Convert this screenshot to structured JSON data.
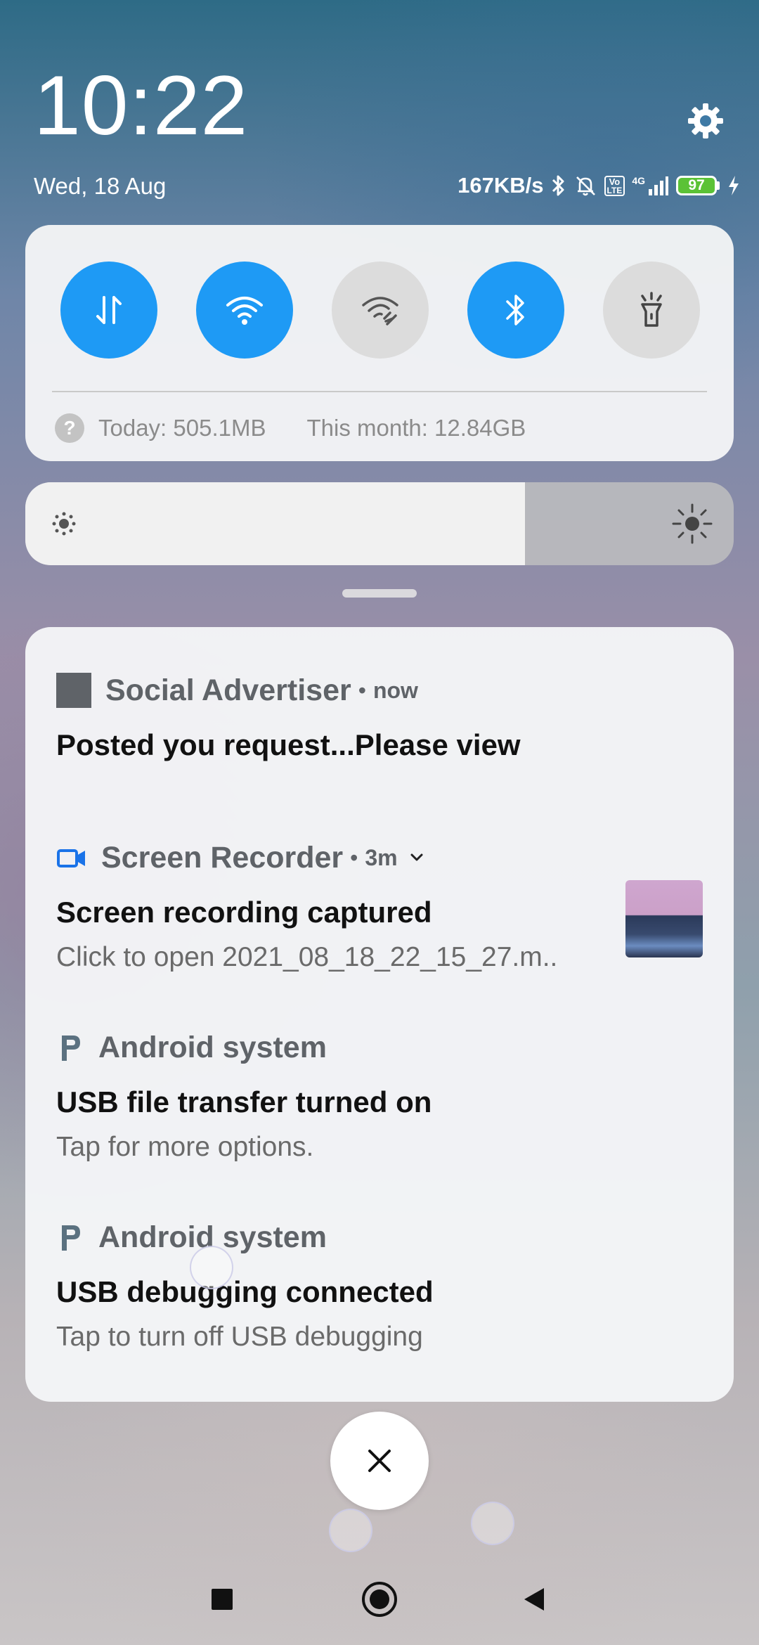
{
  "status_bar": {
    "time": "10:22",
    "date": "Wed, 18 Aug",
    "network_speed": "167KB/s",
    "battery": "97",
    "network_type": "4G",
    "volte_top": "Vo",
    "volte_bottom": "LTE"
  },
  "quick_settings": {
    "toggles": [
      {
        "name": "mobile-data",
        "state": "on"
      },
      {
        "name": "wifi",
        "state": "on"
      },
      {
        "name": "hotspot",
        "state": "off"
      },
      {
        "name": "bluetooth",
        "state": "on"
      },
      {
        "name": "flashlight",
        "state": "off"
      }
    ],
    "data_today": "Today: 505.1MB",
    "data_month": "This month: 12.84GB",
    "help_glyph": "?"
  },
  "brightness": {
    "level_fraction": 0.705
  },
  "notifications": [
    {
      "app": "Social Advertiser",
      "time": "now",
      "title": "Posted you request...Please view",
      "text": ""
    },
    {
      "app": "Screen Recorder",
      "time": "3m",
      "title": "Screen recording captured",
      "text": "Click to open 2021_08_18_22_15_27.m.."
    },
    {
      "app": "Android system",
      "time": "",
      "title": "USB file transfer turned on",
      "text": "Tap for more options."
    },
    {
      "app": "Android system",
      "time": "",
      "title": "USB debugging connected",
      "text": "Tap to turn off USB debugging"
    }
  ],
  "colors": {
    "accent": "#1e9af5",
    "battery_fill": "#5bc236"
  },
  "icons": {
    "settings": "gear-icon",
    "dismiss_all": "close-icon",
    "nav": [
      "recents-icon",
      "home-icon",
      "back-icon"
    ]
  }
}
